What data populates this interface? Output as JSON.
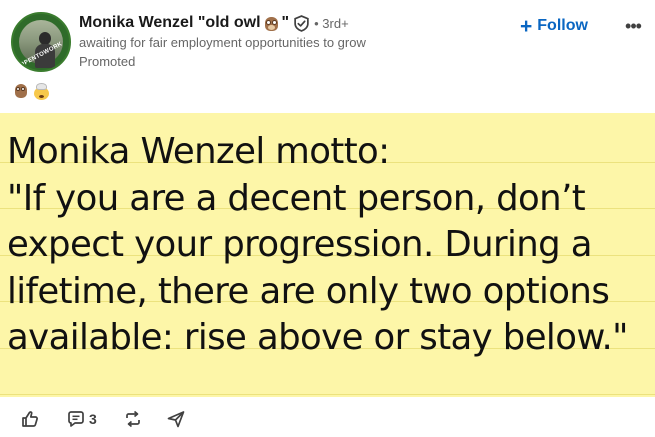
{
  "post": {
    "author": {
      "name": "Monika Wenzel \"old owl",
      "name_suffix": "\"",
      "name_emoji": "owl-emoji",
      "avatar_ring_text": "#OPENTOWORK",
      "verified_icon": "verified-shield-icon",
      "degree": "• 3rd+",
      "headline": "awaiting for fair employment opportunities to grow",
      "promoted": "Promoted"
    },
    "reaction_emojis": [
      "owl-emoji",
      "mind-blown-emoji"
    ],
    "follow_label": "Follow",
    "follow_icon": "plus-icon",
    "more_icon": "more-horizontal-icon",
    "more_glyph": "•••",
    "image_text": "Monika Wenzel motto:\n\"If you are a decent person, don’t\nexpect your progression. During a\nlifetime, there are only two options\navailable: rise above or stay below.\"",
    "image_background": "#fdf6a8",
    "actions": [
      {
        "name": "like",
        "icon": "thumbs-up-icon"
      },
      {
        "name": "comment",
        "icon": "comment-icon",
        "count": "3"
      },
      {
        "name": "repost",
        "icon": "repost-icon"
      },
      {
        "name": "send",
        "icon": "send-icon"
      }
    ],
    "accent_color": "#0a66c2"
  }
}
